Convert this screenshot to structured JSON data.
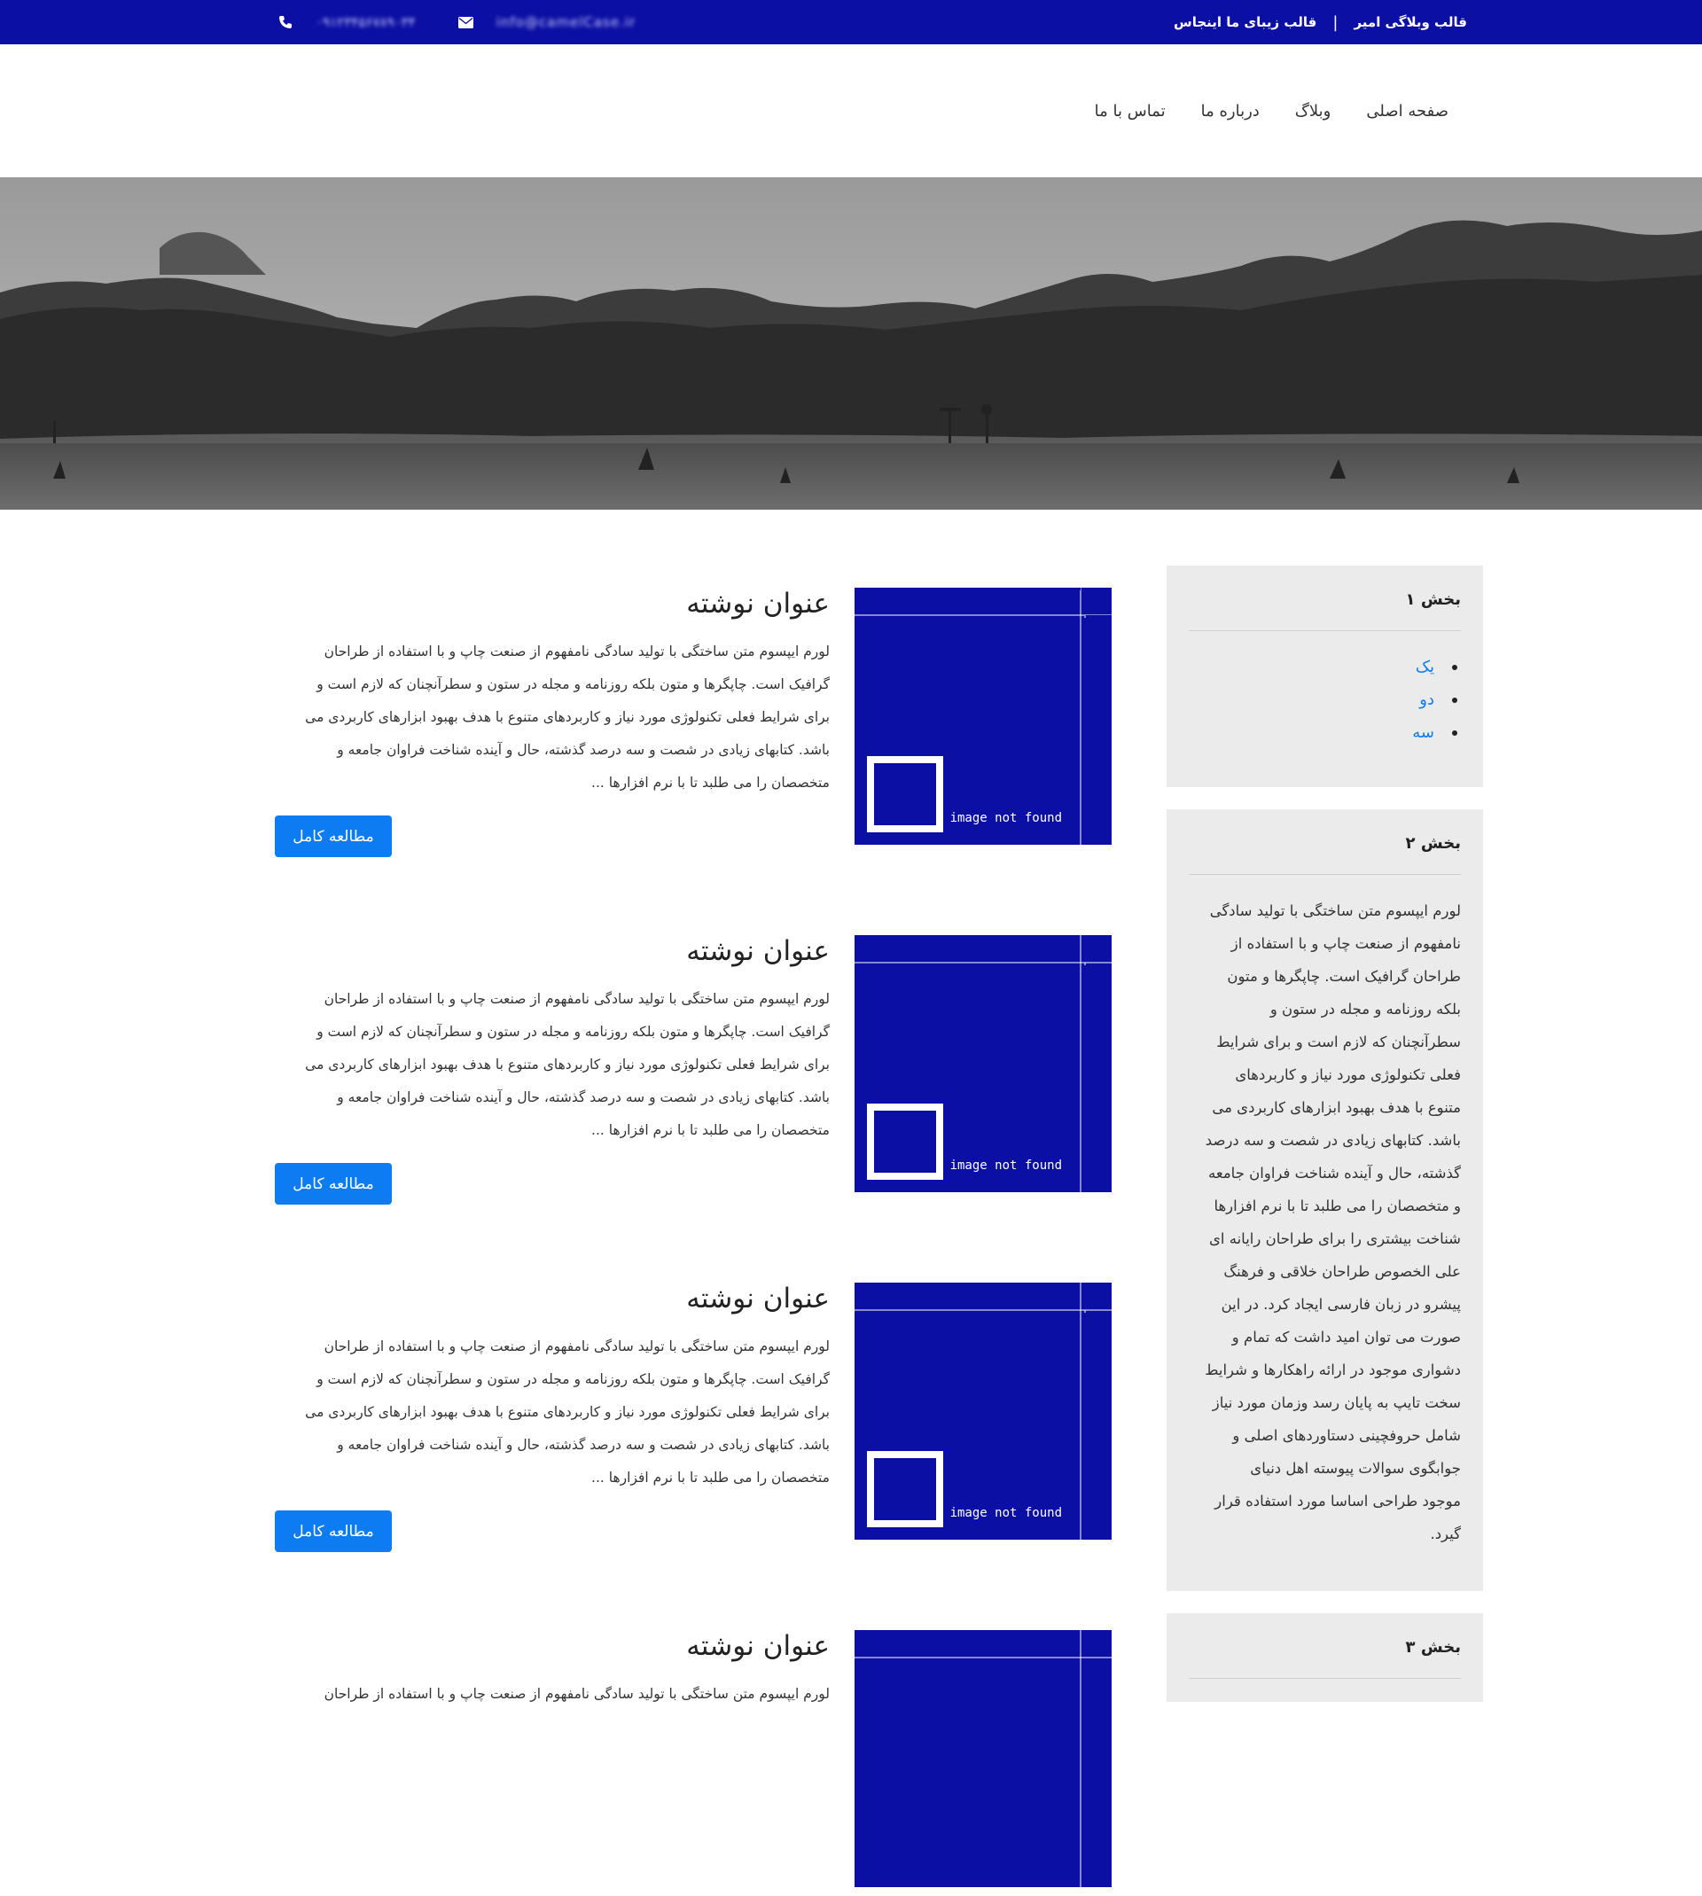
{
  "topbar": {
    "brand_title": "قالب وبلاگی امیر",
    "separator": "|",
    "brand_tagline": "قالب زیبای ما اینجاس",
    "email": "info@camelCase.ir",
    "phone": "۰۹۱۲۳۴۵۶۷۸۹۰۳۴",
    "email_icon": "envelope-icon",
    "phone_icon": "phone-icon",
    "background_color": "#0c0fa3"
  },
  "nav": {
    "items": [
      {
        "label": "صفحه اصلی"
      },
      {
        "label": "وبلاگ"
      },
      {
        "label": "درباره ما"
      },
      {
        "label": "تماس با ما"
      }
    ]
  },
  "hero": {
    "image": "desert-mountains-grayscale-photo"
  },
  "posts": [
    {
      "title": "عنوان نوشته",
      "lines": [
        "لورم ایپسوم متن ساختگی با تولید سادگی نامفهوم از صنعت چاپ و با استفاده از طراحان",
        "گرافیک است. چاپگرها و متون بلکه روزنامه و مجله در ستون و سطرآنچنان که لازم است و",
        "برای شرایط فعلی تکنولوژی مورد نیاز و کاربردهای متنوع با هدف بهبود ابزارهای کاربردی می",
        "باشد. کتابهای زیادی در شصت و سه درصد گذشته، حال و آینده شناخت فراوان جامعه و",
        "متخصصان را می طلبد تا با نرم افزارها ..."
      ],
      "button": "مطالعه کامل",
      "image_placeholder": "image not found"
    },
    {
      "title": "عنوان نوشته",
      "lines": [
        "لورم ایپسوم متن ساختگی با تولید سادگی نامفهوم از صنعت چاپ و با استفاده از طراحان",
        "گرافیک است. چاپگرها و متون بلکه روزنامه و مجله در ستون و سطرآنچنان که لازم است و",
        "برای شرایط فعلی تکنولوژی مورد نیاز و کاربردهای متنوع با هدف بهبود ابزارهای کاربردی می",
        "باشد. کتابهای زیادی در شصت و سه درصد گذشته، حال و آینده شناخت فراوان جامعه و",
        "متخصصان را می طلبد تا با نرم افزارها ..."
      ],
      "button": "مطالعه کامل",
      "image_placeholder": "image not found"
    },
    {
      "title": "عنوان نوشته",
      "lines": [
        "لورم ایپسوم متن ساختگی با تولید سادگی نامفهوم از صنعت چاپ و با استفاده از طراحان",
        "گرافیک است. چاپگرها و متون بلکه روزنامه و مجله در ستون و سطرآنچنان که لازم است و",
        "برای شرایط فعلی تکنولوژی مورد نیاز و کاربردهای متنوع با هدف بهبود ابزارهای کاربردی می",
        "باشد. کتابهای زیادی در شصت و سه درصد گذشته، حال و آینده شناخت فراوان جامعه و",
        "متخصصان را می طلبد تا با نرم افزارها ..."
      ],
      "button": "مطالعه کامل",
      "image_placeholder": "image not found"
    },
    {
      "title": "عنوان نوشته",
      "lines": [
        "لورم ایپسوم متن ساختگی با تولید سادگی نامفهوم از صنعت چاپ و با استفاده از طراحان"
      ],
      "button": "",
      "image_placeholder": ""
    }
  ],
  "sidebar": {
    "widget1": {
      "title": "بخش ۱",
      "links": [
        "یک",
        "دو",
        "سه"
      ]
    },
    "widget2": {
      "title": "بخش ۲",
      "lines": [
        "لورم ایپسوم متن ساختگی با تولید سادگی",
        "نامفهوم از صنعت چاپ و با استفاده از",
        "طراحان گرافیک است. چاپگرها و متون",
        "بلکه روزنامه و مجله در ستون و",
        "سطرآنچنان که لازم است و برای شرایط",
        "فعلی تکنولوژی مورد نیاز و کاربردهای",
        "متنوع با هدف بهبود ابزارهای کاربردی می",
        "باشد. کتابهای زیادی در شصت و سه درصد",
        "گذشته، حال و آینده شناخت فراوان جامعه",
        "و متخصصان را می طلبد تا با نرم افزارها",
        "شناخت بیشتری را برای طراحان رایانه ای",
        "علی الخصوص طراحان خلاقی و فرهنگ",
        "پیشرو در زبان فارسی ایجاد کرد. در این",
        "صورت می توان امید داشت که تمام و",
        "دشواری موجود در ارائه راهکارها و شرایط",
        "سخت تایپ به پایان رسد وزمان مورد نیاز",
        "شامل حروفچینی دستاوردهای اصلی و",
        "جوابگوی سوالات پیوسته اهل دنیای",
        "موجود طراحی اساسا مورد استفاده قرار",
        "گیرد."
      ]
    },
    "widget3": {
      "title": "بخش ۳"
    }
  },
  "colors": {
    "accent": "#0c0fa3",
    "button": "#0d7cf2",
    "sidebar_bg": "#ebebeb"
  }
}
